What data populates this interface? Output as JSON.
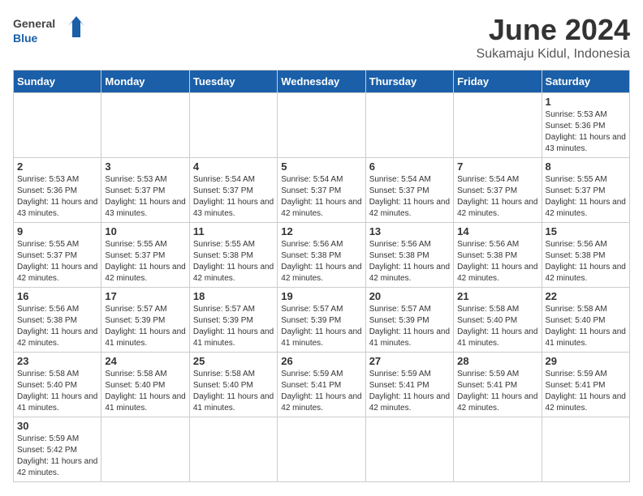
{
  "header": {
    "logo_general": "General",
    "logo_blue": "Blue",
    "title": "June 2024",
    "location": "Sukamaju Kidul, Indonesia"
  },
  "weekdays": [
    "Sunday",
    "Monday",
    "Tuesday",
    "Wednesday",
    "Thursday",
    "Friday",
    "Saturday"
  ],
  "days": {
    "1": {
      "sunrise": "5:53 AM",
      "sunset": "5:36 PM",
      "daylight": "11 hours and 43 minutes."
    },
    "2": {
      "sunrise": "5:53 AM",
      "sunset": "5:36 PM",
      "daylight": "11 hours and 43 minutes."
    },
    "3": {
      "sunrise": "5:53 AM",
      "sunset": "5:37 PM",
      "daylight": "11 hours and 43 minutes."
    },
    "4": {
      "sunrise": "5:54 AM",
      "sunset": "5:37 PM",
      "daylight": "11 hours and 43 minutes."
    },
    "5": {
      "sunrise": "5:54 AM",
      "sunset": "5:37 PM",
      "daylight": "11 hours and 42 minutes."
    },
    "6": {
      "sunrise": "5:54 AM",
      "sunset": "5:37 PM",
      "daylight": "11 hours and 42 minutes."
    },
    "7": {
      "sunrise": "5:54 AM",
      "sunset": "5:37 PM",
      "daylight": "11 hours and 42 minutes."
    },
    "8": {
      "sunrise": "5:55 AM",
      "sunset": "5:37 PM",
      "daylight": "11 hours and 42 minutes."
    },
    "9": {
      "sunrise": "5:55 AM",
      "sunset": "5:37 PM",
      "daylight": "11 hours and 42 minutes."
    },
    "10": {
      "sunrise": "5:55 AM",
      "sunset": "5:37 PM",
      "daylight": "11 hours and 42 minutes."
    },
    "11": {
      "sunrise": "5:55 AM",
      "sunset": "5:38 PM",
      "daylight": "11 hours and 42 minutes."
    },
    "12": {
      "sunrise": "5:56 AM",
      "sunset": "5:38 PM",
      "daylight": "11 hours and 42 minutes."
    },
    "13": {
      "sunrise": "5:56 AM",
      "sunset": "5:38 PM",
      "daylight": "11 hours and 42 minutes."
    },
    "14": {
      "sunrise": "5:56 AM",
      "sunset": "5:38 PM",
      "daylight": "11 hours and 42 minutes."
    },
    "15": {
      "sunrise": "5:56 AM",
      "sunset": "5:38 PM",
      "daylight": "11 hours and 42 minutes."
    },
    "16": {
      "sunrise": "5:56 AM",
      "sunset": "5:38 PM",
      "daylight": "11 hours and 42 minutes."
    },
    "17": {
      "sunrise": "5:57 AM",
      "sunset": "5:39 PM",
      "daylight": "11 hours and 41 minutes."
    },
    "18": {
      "sunrise": "5:57 AM",
      "sunset": "5:39 PM",
      "daylight": "11 hours and 41 minutes."
    },
    "19": {
      "sunrise": "5:57 AM",
      "sunset": "5:39 PM",
      "daylight": "11 hours and 41 minutes."
    },
    "20": {
      "sunrise": "5:57 AM",
      "sunset": "5:39 PM",
      "daylight": "11 hours and 41 minutes."
    },
    "21": {
      "sunrise": "5:58 AM",
      "sunset": "5:40 PM",
      "daylight": "11 hours and 41 minutes."
    },
    "22": {
      "sunrise": "5:58 AM",
      "sunset": "5:40 PM",
      "daylight": "11 hours and 41 minutes."
    },
    "23": {
      "sunrise": "5:58 AM",
      "sunset": "5:40 PM",
      "daylight": "11 hours and 41 minutes."
    },
    "24": {
      "sunrise": "5:58 AM",
      "sunset": "5:40 PM",
      "daylight": "11 hours and 41 minutes."
    },
    "25": {
      "sunrise": "5:58 AM",
      "sunset": "5:40 PM",
      "daylight": "11 hours and 41 minutes."
    },
    "26": {
      "sunrise": "5:59 AM",
      "sunset": "5:41 PM",
      "daylight": "11 hours and 42 minutes."
    },
    "27": {
      "sunrise": "5:59 AM",
      "sunset": "5:41 PM",
      "daylight": "11 hours and 42 minutes."
    },
    "28": {
      "sunrise": "5:59 AM",
      "sunset": "5:41 PM",
      "daylight": "11 hours and 42 minutes."
    },
    "29": {
      "sunrise": "5:59 AM",
      "sunset": "5:41 PM",
      "daylight": "11 hours and 42 minutes."
    },
    "30": {
      "sunrise": "5:59 AM",
      "sunset": "5:42 PM",
      "daylight": "11 hours and 42 minutes."
    }
  }
}
